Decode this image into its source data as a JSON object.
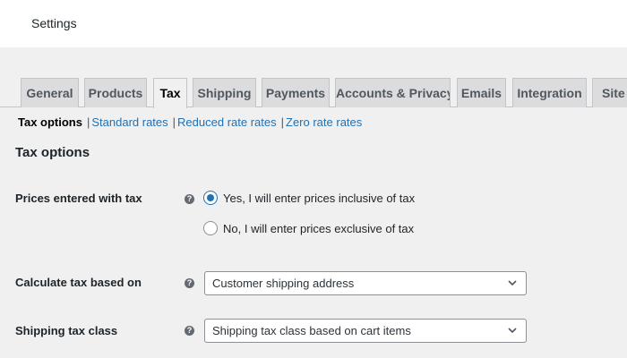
{
  "header": {
    "title": "Settings"
  },
  "tabs": [
    {
      "label": "General"
    },
    {
      "label": "Products"
    },
    {
      "label": "Tax",
      "active": true
    },
    {
      "label": "Shipping"
    },
    {
      "label": "Payments"
    },
    {
      "label": "Accounts & Privacy"
    },
    {
      "label": "Emails"
    },
    {
      "label": "Integration"
    },
    {
      "label": "Site v"
    }
  ],
  "subnav": {
    "current": "Tax options",
    "links": [
      "Standard rates",
      "Reduced rate rates",
      "Zero rate rates"
    ],
    "separator": "|"
  },
  "section": {
    "title": "Tax options"
  },
  "fields": {
    "prices_entered_with_tax": {
      "label": "Prices entered with tax",
      "help_icon": "question-circle-icon",
      "options": [
        {
          "label": "Yes, I will enter prices inclusive of tax",
          "checked": true
        },
        {
          "label": "No, I will enter prices exclusive of tax",
          "checked": false
        }
      ]
    },
    "calculate_tax_based_on": {
      "label": "Calculate tax based on",
      "help_icon": "question-circle-icon",
      "value": "Customer shipping address"
    },
    "shipping_tax_class": {
      "label": "Shipping tax class",
      "help_icon": "question-circle-icon",
      "value": "Shipping tax class based on cart items"
    }
  },
  "help_glyph": "?",
  "colors": {
    "accent": "#2271b1",
    "background": "#f0f0f1",
    "tab_bg": "#dcdcde",
    "text": "#1d2327"
  }
}
